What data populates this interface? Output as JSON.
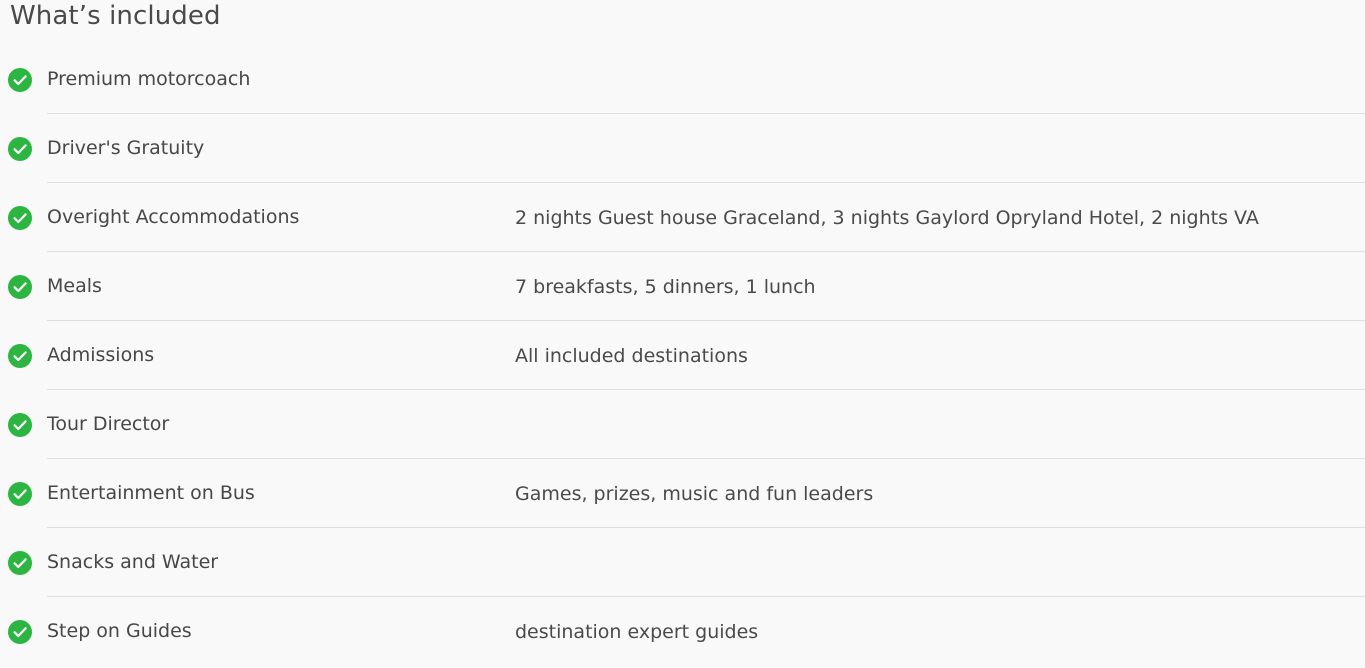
{
  "section": {
    "title": "What’s included",
    "items": [
      {
        "label": "Premium motorcoach",
        "detail": ""
      },
      {
        "label": "Driver's Gratuity",
        "detail": ""
      },
      {
        "label": "Overight Accommodations",
        "detail": "2 nights Guest house Graceland, 3 nights Gaylord Opryland Hotel, 2 nights VA"
      },
      {
        "label": "Meals",
        "detail": "7 breakfasts, 5 dinners, 1 lunch"
      },
      {
        "label": "Admissions",
        "detail": "All included destinations"
      },
      {
        "label": "Tour Director",
        "detail": ""
      },
      {
        "label": "Entertainment on Bus",
        "detail": "Games, prizes, music and fun leaders"
      },
      {
        "label": "Snacks and Water",
        "detail": ""
      },
      {
        "label": "Step on Guides",
        "detail": "destination expert guides"
      }
    ]
  },
  "colors": {
    "check": "#2db542",
    "divider": "#dedede",
    "background": "#f9f9f9",
    "text": "#474747"
  },
  "icons": {
    "included": "check-circle-icon"
  }
}
